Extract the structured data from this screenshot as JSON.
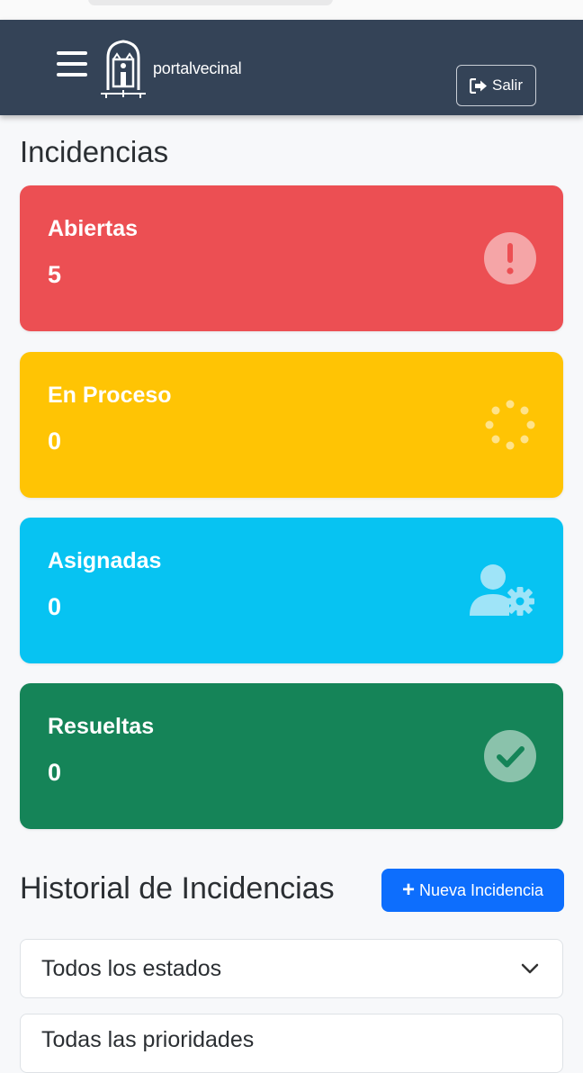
{
  "navbar": {
    "logo_text": "portalvecinal",
    "logout_label": "Salir"
  },
  "page_title": "Incidencias",
  "cards": [
    {
      "label": "Abiertas",
      "value": "5",
      "icon": "exclamation-circle-icon",
      "color": "#ec4f53"
    },
    {
      "label": "En Proceso",
      "value": "0",
      "icon": "spinner-icon",
      "color": "#ffc404"
    },
    {
      "label": "Asignadas",
      "value": "0",
      "icon": "user-gear-icon",
      "color": "#07c3f2"
    },
    {
      "label": "Resueltas",
      "value": "0",
      "icon": "check-circle-icon",
      "color": "#158458"
    }
  ],
  "history": {
    "title": "Historial de Incidencias",
    "new_button_label": "Nueva Incidencia",
    "status_filter_value": "Todos los estados",
    "priority_filter_value": "Todas las prioridades"
  },
  "colors": {
    "navbar": "#344357",
    "primary": "#0d6efd"
  }
}
